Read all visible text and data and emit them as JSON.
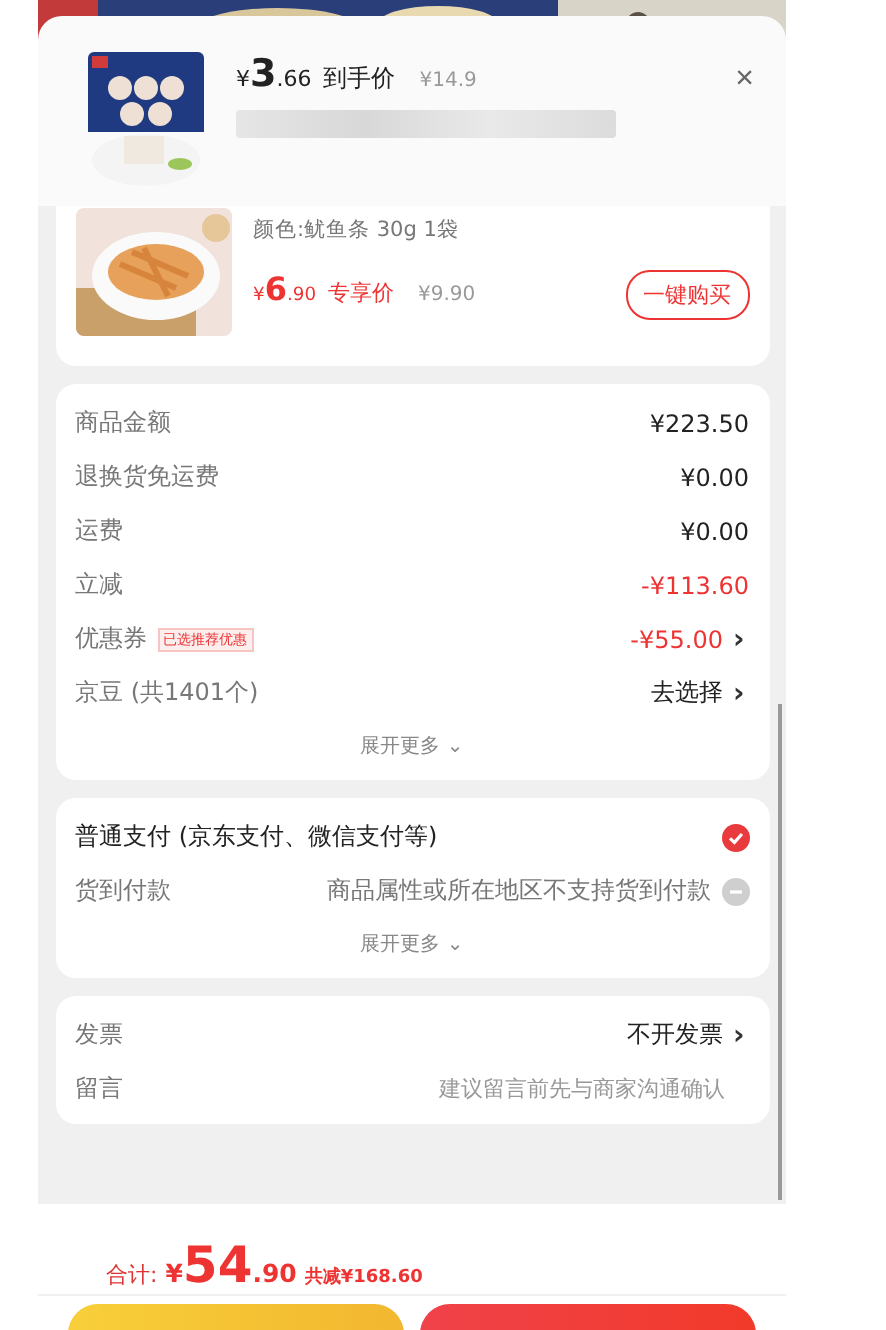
{
  "popup": {
    "currency": "¥",
    "price_int": "3",
    "price_dec": ".66",
    "price_label": "到手价",
    "original_price": "¥14.9",
    "close": "×"
  },
  "product": {
    "spec": "颜色:鱿鱼条 30g 1袋",
    "currency": "¥",
    "price_int": "6",
    "price_dec": ".90",
    "price_label": "专享价",
    "original_price": "¥9.90",
    "buy_button": "一键购买"
  },
  "fees": {
    "rows": [
      {
        "label": "商品金额",
        "value": "¥223.50",
        "highlight": false
      },
      {
        "label": "退换货免运费",
        "value": "¥0.00",
        "highlight": false
      },
      {
        "label": "运费",
        "value": "¥0.00",
        "highlight": false
      },
      {
        "label": "立减",
        "value": "-¥113.60",
        "highlight": true
      },
      {
        "label": "优惠券",
        "tag": "已选推荐优惠",
        "value": "-¥55.00",
        "highlight": true,
        "arrow": "›"
      },
      {
        "label": "京豆 (共1401个)",
        "value": "去选择",
        "highlight": false,
        "arrow": "›"
      }
    ],
    "expand": "展开更多 ⌄"
  },
  "payment": {
    "options": [
      {
        "label": "普通支付 (京东支付、微信支付等)",
        "selected": true,
        "disabled": false
      },
      {
        "label": "货到付款",
        "note": "商品属性或所在地区不支持货到付款",
        "selected": false,
        "disabled": true
      }
    ],
    "expand": "展开更多 ⌄"
  },
  "extras": [
    {
      "label": "发票",
      "value": "不开发票",
      "arrow": "›",
      "kind": "link"
    },
    {
      "label": "留言",
      "value": "建议留言前先与商家沟通确认",
      "kind": "hint"
    }
  ],
  "footer": {
    "total_label": "合计:",
    "currency": "¥",
    "total_int": "54",
    "total_dec": ".90",
    "saved": "共减¥168.60"
  }
}
